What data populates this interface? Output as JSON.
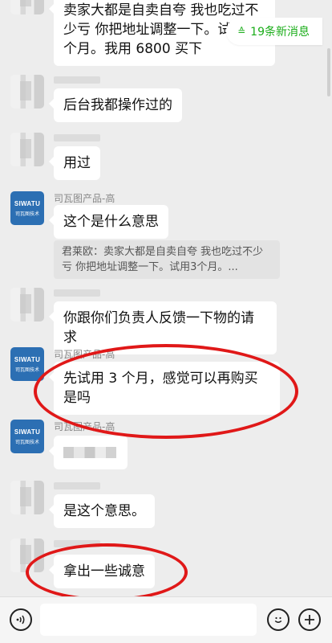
{
  "new_messages": {
    "count_label": "19条新消息"
  },
  "messages": [
    {
      "type": "text",
      "sender": "",
      "text": "卖家大都是自卖自夸 我也吃过不少亏  你把地址调整一下。试用3个月。我用 6800 买下"
    },
    {
      "type": "text",
      "sender": "",
      "text": "后台我都操作过的"
    },
    {
      "type": "text",
      "sender": "",
      "text": "用过"
    },
    {
      "type": "text",
      "sender": "司瓦图产品-高",
      "text": "这个是什么意思"
    },
    {
      "type": "quote",
      "text": "君莱欧：卖家大都是自卖自夸 我也吃过不少亏  你把地址调整一下。试用3个月。..."
    },
    {
      "type": "text",
      "sender": "",
      "text": "你跟你们负责人反馈一下物的请求"
    },
    {
      "type": "text",
      "sender": "司瓦图产品-高",
      "text": "先试用 3 个月，感觉可以再购买是吗"
    },
    {
      "type": "blurred",
      "sender": "司瓦图产品-高",
      "text": ""
    },
    {
      "type": "text",
      "sender": "",
      "text": "是这个意思。"
    },
    {
      "type": "text",
      "sender": "",
      "text": "拿出一些诚意"
    }
  ],
  "brand_avatar": {
    "line1": "SIWATU",
    "line2": "司瓦图技术"
  },
  "input": {
    "value": ""
  },
  "icons": {
    "voice": "voice-icon",
    "emoji": "emoji-icon",
    "plus": "plus-icon"
  },
  "colors": {
    "background": "#ededed",
    "bubble": "#ffffff",
    "accent_green": "#1aad19",
    "annotation_red": "#e01818",
    "brand_blue": "#2c6fb3"
  }
}
